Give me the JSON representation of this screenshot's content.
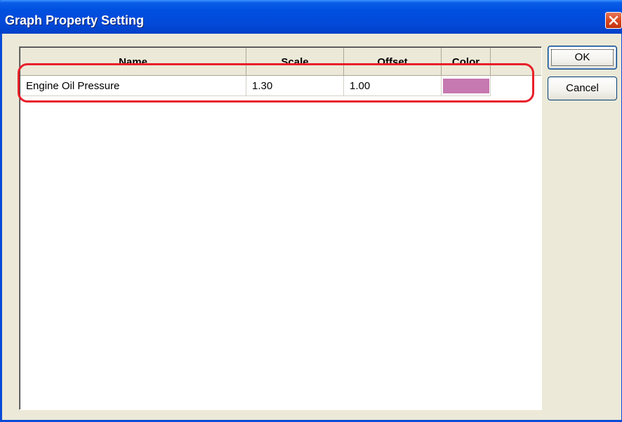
{
  "window": {
    "title": "Graph Property Setting"
  },
  "table": {
    "columns": [
      "Name",
      "Scale",
      "Offset",
      "Color"
    ],
    "rows": [
      {
        "name": "Engine Oil Pressure",
        "scale": "1.30",
        "offset": "1.00",
        "color": "#c678b0"
      }
    ]
  },
  "buttons": {
    "ok_label": "OK",
    "cancel_label": "Cancel"
  },
  "colors": {
    "titlebar": "#0050e0",
    "highlight": "#e8202a",
    "swatch": "#c678b0"
  }
}
